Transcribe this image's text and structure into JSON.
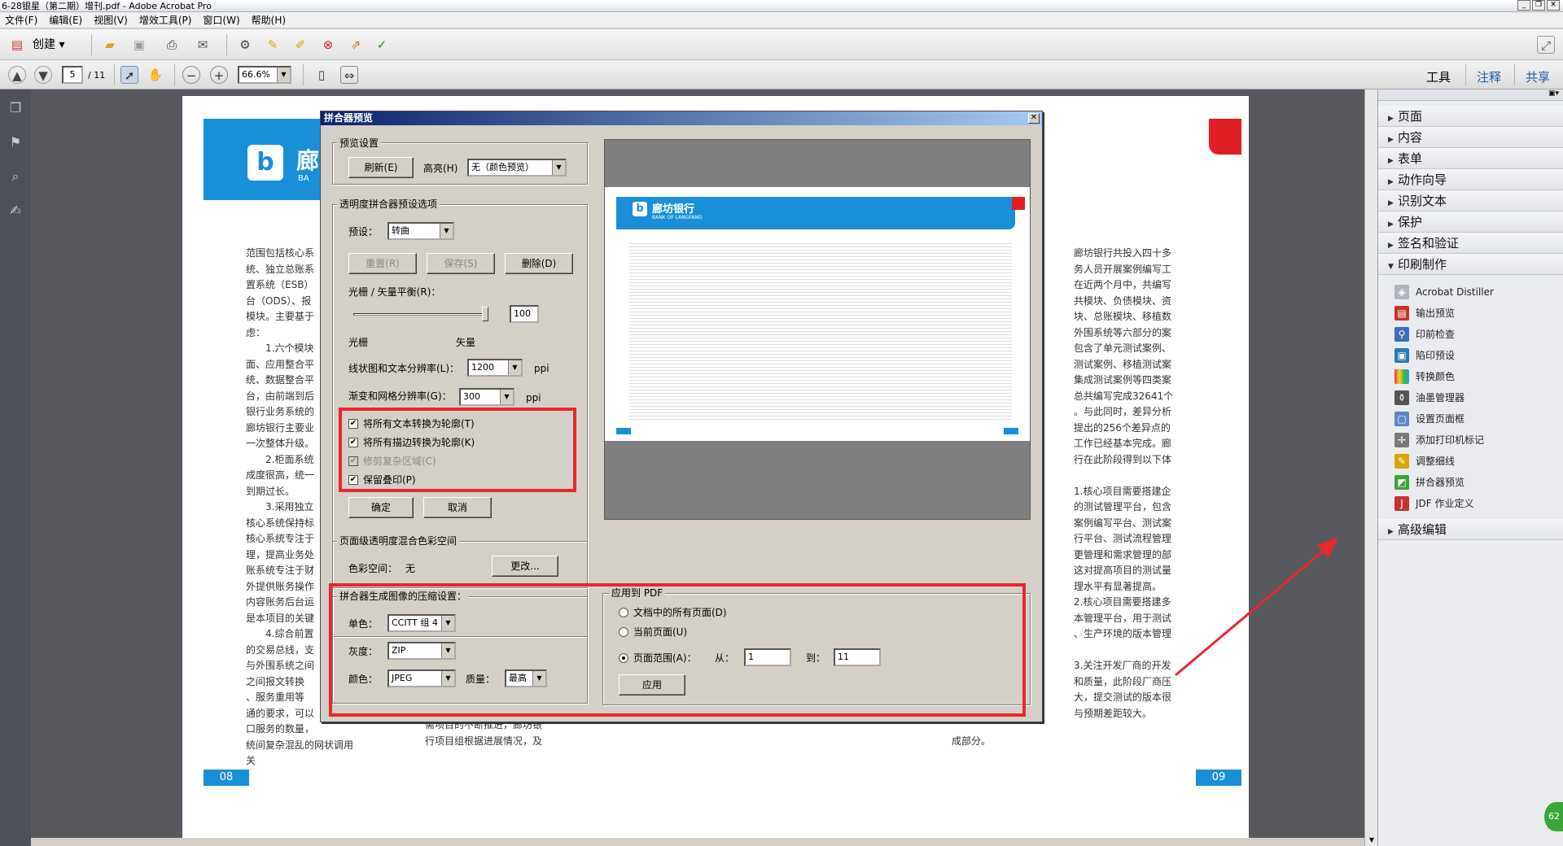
{
  "window": {
    "title": "6-28银星（第二期）增刊.pdf - Adobe Acrobat Pro"
  },
  "menu": [
    "文件(F)",
    "编辑(E)",
    "视图(V)",
    "增效工具(P)",
    "窗口(W)",
    "帮助(H)"
  ],
  "toolbar": {
    "create_label": "创建",
    "page_current": "5",
    "page_total": "/ 11",
    "zoom": "66.6%"
  },
  "top_tabs": {
    "tools": "工具",
    "comment": "注释",
    "share": "共享"
  },
  "right_panel": {
    "sections_top": [
      "页面",
      "内容",
      "表单",
      "动作向导",
      "识别文本",
      "保护",
      "签名和验证"
    ],
    "expanded_section": "印刷制作",
    "tools": [
      "Acrobat Distiller",
      "输出预览",
      "印前检查",
      "陷印预设",
      "转换颜色",
      "油墨管理器",
      "设置页面框",
      "添加打印机标记",
      "调整细线",
      "拼合器预览",
      "JDF 作业定义"
    ],
    "section_bottom": "高级编辑",
    "badge": "62"
  },
  "document": {
    "left_page_number": "08",
    "right_page_number": "09",
    "left_col": [
      "范围包括核心系",
      "统、独立总账系",
      "置系统（ESB）",
      "台（ODS）、报",
      "模块。主要基于",
      "虑：",
      "　　1.六个模块",
      "面、应用整合平",
      "统、数据整合平",
      "台，由前端到后",
      "银行业务系统的",
      "廊坊银行主要业",
      "一次整体升级。",
      "　　2.柜面系统",
      "成度很高，统一",
      "到期过长。",
      "　　3.采用独立",
      "核心系统保持标",
      "核心系统专注于",
      "理，提高业务处",
      "账系统专注于财",
      "外提供账务操作",
      "内容账务后台运",
      "是本项目的关键",
      "　　4.综合前置",
      "的交易总线，支",
      "与外围系统之间",
      "之间报文转换",
      "、服务重用等",
      "通的要求，可以",
      "口服务的数量，",
      "统间复杂混乱的网状调用关"
    ],
    "mid_bottom_1": [
      "需项目的不断推进，廊坊银",
      "行项目组根据进展情况，及"
    ],
    "mid_bottom_2": "成部分。",
    "right_col": [
      "廊坊银行共投入四十多",
      "务人员开展案例编写工",
      "在近两个月中，共编写",
      "共模块、负债模块、资",
      "块、总账模块、移植数",
      "外围系统等六部分的案",
      "包含了单元测试案例、",
      "测试案例、移植测试案",
      "集成测试案例等四类案",
      "总共编写完成32641个",
      "。与此同时，差异分析",
      "提出的256个差异点的",
      "工作已经基本完成。廊",
      "行在此阶段得到以下体",
      "",
      "1.核心项目需要搭建企",
      "的测试管理平台，包含",
      "案例编写平台、测试案",
      "行平台、测试流程管理",
      "更管理和需求管理的部",
      "这对提高项目的测试量",
      "理水平有显著提高。",
      "2.核心项目需要搭建多",
      "本管理平台，用于测试",
      "、生产环境的版本管理",
      "",
      "3.关注开发厂商的开发",
      "和质量，此阶段厂商压",
      "大，提交测试的版本很",
      "与预期差距较大。"
    ],
    "header_logo_text": "廊",
    "header_logo_sub": "BA"
  },
  "dialog": {
    "title": "拼合器预览",
    "preview_settings": {
      "legend": "预览设置",
      "refresh": "刷新(E)",
      "highlight_label": "高亮(H)",
      "highlight_value": "无（颜色预览）"
    },
    "transparency": {
      "legend": "透明度拼合器预设选项",
      "preset_label": "预设：",
      "preset_value": "转曲",
      "reset": "重置(R)",
      "save": "保存(S)",
      "delete": "删除(D)",
      "balance_label": "光栅 / 矢量平衡(R)：",
      "balance_value": "100",
      "raster": "光栅",
      "vector": "矢量",
      "line_res_label": "线状图和文本分辨率(L)：",
      "line_res_value": "1200",
      "gradient_label": "渐变和网格分辨率(G)：",
      "gradient_value": "300",
      "ppi": "ppi",
      "cb_text_outline": "将所有文本转换为轮廓(T)",
      "cb_stroke_outline": "将所有描边转换为轮廓(K)",
      "cb_clip_complex": "修剪复杂区域(C)",
      "cb_preserve_overprint": "保留叠印(P)",
      "ok": "确定",
      "cancel": "取消"
    },
    "page_blend": {
      "legend": "页面级透明度混合色彩空间",
      "color_space_label": "色彩空间：",
      "color_space_value": "无",
      "change": "更改..."
    },
    "compression": {
      "legend": "拼合器生成图像的压缩设置：",
      "mono_label": "单色：",
      "mono_value": "CCITT 组 4",
      "gray_label": "灰度：",
      "gray_value": "ZIP",
      "color_label": "颜色：",
      "color_value": "JPEG",
      "quality_label": "质量：",
      "quality_value": "最高"
    },
    "apply_pdf": {
      "legend": "应用到 PDF",
      "all_pages": "文档中的所有页面(D)",
      "current_page": "当前页面(U)",
      "page_range": "页面范围(A)：",
      "from_label": "从：",
      "from_value": "1",
      "to_label": "到：",
      "to_value": "11",
      "apply": "应用"
    },
    "preview_thumb": {
      "bank_name": "廊坊银行",
      "bank_sub": "BANK OF LANGFANG"
    }
  },
  "colors": {
    "accent_blue": "#1a8fd9",
    "annotation_red": "#e8272f",
    "panel_bg": "#d4d0c8"
  }
}
